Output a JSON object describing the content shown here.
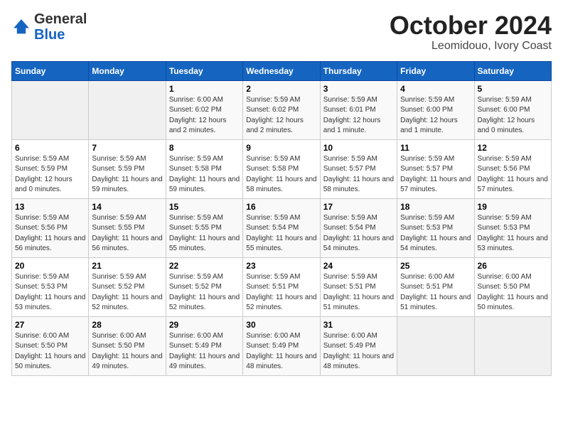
{
  "header": {
    "logo_general": "General",
    "logo_blue": "Blue",
    "title": "October 2024",
    "subtitle": "Leomidouo, Ivory Coast"
  },
  "weekdays": [
    "Sunday",
    "Monday",
    "Tuesday",
    "Wednesday",
    "Thursday",
    "Friday",
    "Saturday"
  ],
  "weeks": [
    [
      {
        "day": "",
        "info": ""
      },
      {
        "day": "",
        "info": ""
      },
      {
        "day": "1",
        "info": "Sunrise: 6:00 AM\nSunset: 6:02 PM\nDaylight: 12 hours and 2 minutes."
      },
      {
        "day": "2",
        "info": "Sunrise: 5:59 AM\nSunset: 6:02 PM\nDaylight: 12 hours and 2 minutes."
      },
      {
        "day": "3",
        "info": "Sunrise: 5:59 AM\nSunset: 6:01 PM\nDaylight: 12 hours and 1 minute."
      },
      {
        "day": "4",
        "info": "Sunrise: 5:59 AM\nSunset: 6:00 PM\nDaylight: 12 hours and 1 minute."
      },
      {
        "day": "5",
        "info": "Sunrise: 5:59 AM\nSunset: 6:00 PM\nDaylight: 12 hours and 0 minutes."
      }
    ],
    [
      {
        "day": "6",
        "info": "Sunrise: 5:59 AM\nSunset: 5:59 PM\nDaylight: 12 hours and 0 minutes."
      },
      {
        "day": "7",
        "info": "Sunrise: 5:59 AM\nSunset: 5:59 PM\nDaylight: 11 hours and 59 minutes."
      },
      {
        "day": "8",
        "info": "Sunrise: 5:59 AM\nSunset: 5:58 PM\nDaylight: 11 hours and 59 minutes."
      },
      {
        "day": "9",
        "info": "Sunrise: 5:59 AM\nSunset: 5:58 PM\nDaylight: 11 hours and 58 minutes."
      },
      {
        "day": "10",
        "info": "Sunrise: 5:59 AM\nSunset: 5:57 PM\nDaylight: 11 hours and 58 minutes."
      },
      {
        "day": "11",
        "info": "Sunrise: 5:59 AM\nSunset: 5:57 PM\nDaylight: 11 hours and 57 minutes."
      },
      {
        "day": "12",
        "info": "Sunrise: 5:59 AM\nSunset: 5:56 PM\nDaylight: 11 hours and 57 minutes."
      }
    ],
    [
      {
        "day": "13",
        "info": "Sunrise: 5:59 AM\nSunset: 5:56 PM\nDaylight: 11 hours and 56 minutes."
      },
      {
        "day": "14",
        "info": "Sunrise: 5:59 AM\nSunset: 5:55 PM\nDaylight: 11 hours and 56 minutes."
      },
      {
        "day": "15",
        "info": "Sunrise: 5:59 AM\nSunset: 5:55 PM\nDaylight: 11 hours and 55 minutes."
      },
      {
        "day": "16",
        "info": "Sunrise: 5:59 AM\nSunset: 5:54 PM\nDaylight: 11 hours and 55 minutes."
      },
      {
        "day": "17",
        "info": "Sunrise: 5:59 AM\nSunset: 5:54 PM\nDaylight: 11 hours and 54 minutes."
      },
      {
        "day": "18",
        "info": "Sunrise: 5:59 AM\nSunset: 5:53 PM\nDaylight: 11 hours and 54 minutes."
      },
      {
        "day": "19",
        "info": "Sunrise: 5:59 AM\nSunset: 5:53 PM\nDaylight: 11 hours and 53 minutes."
      }
    ],
    [
      {
        "day": "20",
        "info": "Sunrise: 5:59 AM\nSunset: 5:53 PM\nDaylight: 11 hours and 53 minutes."
      },
      {
        "day": "21",
        "info": "Sunrise: 5:59 AM\nSunset: 5:52 PM\nDaylight: 11 hours and 52 minutes."
      },
      {
        "day": "22",
        "info": "Sunrise: 5:59 AM\nSunset: 5:52 PM\nDaylight: 11 hours and 52 minutes."
      },
      {
        "day": "23",
        "info": "Sunrise: 5:59 AM\nSunset: 5:51 PM\nDaylight: 11 hours and 52 minutes."
      },
      {
        "day": "24",
        "info": "Sunrise: 5:59 AM\nSunset: 5:51 PM\nDaylight: 11 hours and 51 minutes."
      },
      {
        "day": "25",
        "info": "Sunrise: 6:00 AM\nSunset: 5:51 PM\nDaylight: 11 hours and 51 minutes."
      },
      {
        "day": "26",
        "info": "Sunrise: 6:00 AM\nSunset: 5:50 PM\nDaylight: 11 hours and 50 minutes."
      }
    ],
    [
      {
        "day": "27",
        "info": "Sunrise: 6:00 AM\nSunset: 5:50 PM\nDaylight: 11 hours and 50 minutes."
      },
      {
        "day": "28",
        "info": "Sunrise: 6:00 AM\nSunset: 5:50 PM\nDaylight: 11 hours and 49 minutes."
      },
      {
        "day": "29",
        "info": "Sunrise: 6:00 AM\nSunset: 5:49 PM\nDaylight: 11 hours and 49 minutes."
      },
      {
        "day": "30",
        "info": "Sunrise: 6:00 AM\nSunset: 5:49 PM\nDaylight: 11 hours and 48 minutes."
      },
      {
        "day": "31",
        "info": "Sunrise: 6:00 AM\nSunset: 5:49 PM\nDaylight: 11 hours and 48 minutes."
      },
      {
        "day": "",
        "info": ""
      },
      {
        "day": "",
        "info": ""
      }
    ]
  ]
}
